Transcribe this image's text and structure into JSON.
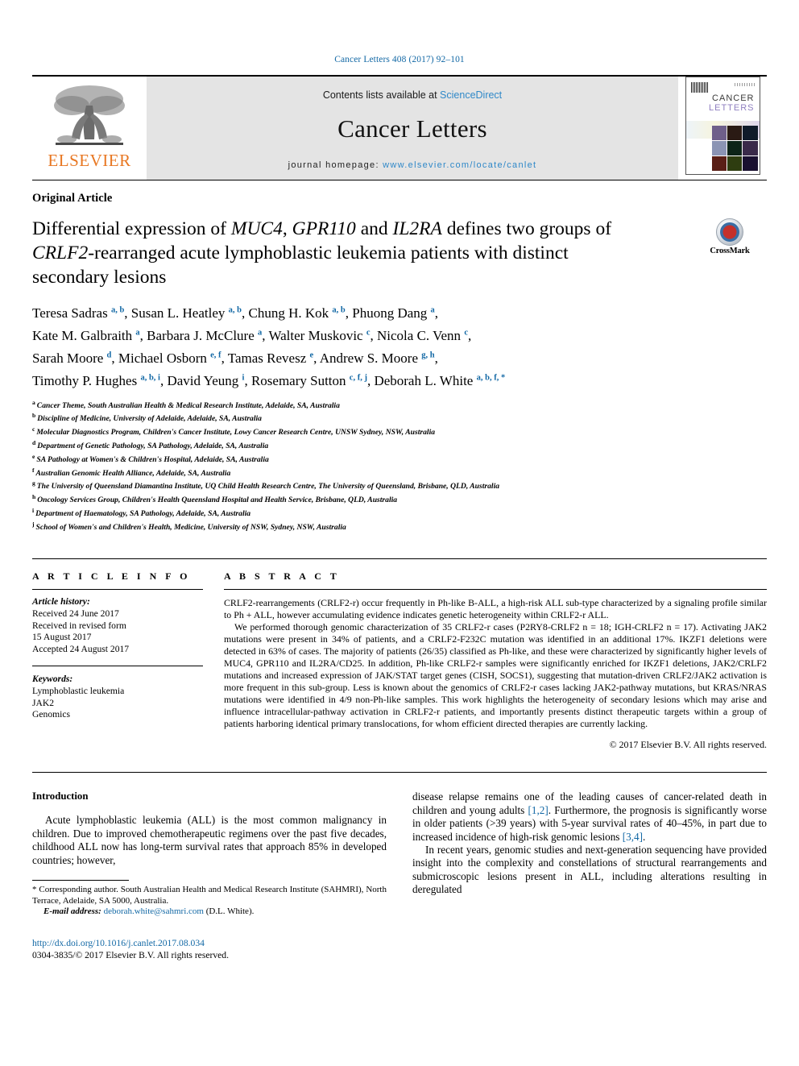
{
  "running_head": "Cancer Letters 408 (2017) 92–101",
  "banner": {
    "publisher_name": "ELSEVIER",
    "contents_prefix": "Contents lists available at ",
    "contents_link": "ScienceDirect",
    "journal_title": "Cancer Letters",
    "homepage_prefix": "journal homepage: ",
    "homepage_url": "www.elsevier.com/locate/canlet",
    "cover": {
      "line1": "CANCER",
      "line2": "LETTERS"
    }
  },
  "article": {
    "type": "Original Article",
    "title_part1": "Differential expression of ",
    "title_gene1": "MUC4",
    "title_part2": ", ",
    "title_gene2": "GPR110",
    "title_part3": " and ",
    "title_gene3": "IL2RA",
    "title_part4": " defines two groups of ",
    "title_gene4": "CRLF2",
    "title_part5": "-rearranged acute lymphoblastic leukemia patients with distinct secondary lesions",
    "crossmark_label": "CrossMark"
  },
  "authors": [
    {
      "name": "Teresa Sadras",
      "sup": "a, b",
      "sep": ", "
    },
    {
      "name": "Susan L. Heatley",
      "sup": "a, b",
      "sep": ", "
    },
    {
      "name": "Chung H. Kok",
      "sup": "a, b",
      "sep": ", "
    },
    {
      "name": "Phuong Dang",
      "sup": "a",
      "sep": ", "
    },
    {
      "name": "Kate M. Galbraith",
      "sup": "a",
      "sep": ", "
    },
    {
      "name": "Barbara J. McClure",
      "sup": "a",
      "sep": ", "
    },
    {
      "name": "Walter Muskovic",
      "sup": "c",
      "sep": ", "
    },
    {
      "name": "Nicola C. Venn",
      "sup": "c",
      "sep": ", "
    },
    {
      "name": "Sarah Moore",
      "sup": "d",
      "sep": ", "
    },
    {
      "name": "Michael Osborn",
      "sup": "e, f",
      "sep": ", "
    },
    {
      "name": "Tamas Revesz",
      "sup": "e",
      "sep": ", "
    },
    {
      "name": "Andrew S. Moore",
      "sup": "g, h",
      "sep": ", "
    },
    {
      "name": "Timothy P. Hughes",
      "sup": "a, b, i",
      "sep": ", "
    },
    {
      "name": "David Yeung",
      "sup": "i",
      "sep": ", "
    },
    {
      "name": "Rosemary Sutton",
      "sup": "c, f, j",
      "sep": ", "
    },
    {
      "name": "Deborah L. White",
      "sup": "a, b, f, *",
      "sep": ""
    }
  ],
  "affiliations": [
    {
      "mark": "a",
      "text": "Cancer Theme, South Australian Health & Medical Research Institute, Adelaide, SA, Australia"
    },
    {
      "mark": "b",
      "text": "Discipline of Medicine, University of Adelaide, Adelaide, SA, Australia"
    },
    {
      "mark": "c",
      "text": "Molecular Diagnostics Program, Children's Cancer Institute, Lowy Cancer Research Centre, UNSW Sydney, NSW, Australia"
    },
    {
      "mark": "d",
      "text": "Department of Genetic Pathology, SA Pathology, Adelaide, SA, Australia"
    },
    {
      "mark": "e",
      "text": "SA Pathology at Women's & Children's Hospital, Adelaide, SA, Australia"
    },
    {
      "mark": "f",
      "text": "Australian Genomic Health Alliance, Adelaide, SA, Australia"
    },
    {
      "mark": "g",
      "text": "The University of Queensland Diamantina Institute, UQ Child Health Research Centre, The University of Queensland, Brisbane, QLD, Australia"
    },
    {
      "mark": "h",
      "text": "Oncology Services Group, Children's Health Queensland Hospital and Health Service, Brisbane, QLD, Australia"
    },
    {
      "mark": "i",
      "text": "Department of Haematology, SA Pathology, Adelaide, SA, Australia"
    },
    {
      "mark": "j",
      "text": "School of Women's and Children's Health, Medicine, University of NSW, Sydney, NSW, Australia"
    }
  ],
  "article_info": {
    "heading": "A R T I C L E  I N F O",
    "history_label": "Article history:",
    "history_lines": [
      "Received 24 June 2017",
      "Received in revised form",
      "15 August 2017",
      "Accepted 24 August 2017"
    ],
    "keywords_label": "Keywords:",
    "keywords": [
      "Lymphoblastic leukemia",
      "JAK2",
      "Genomics"
    ]
  },
  "abstract": {
    "heading": "A B S T R A C T",
    "para1": "CRLF2-rearrangements (CRLF2-r) occur frequently in Ph-like B-ALL, a high-risk ALL sub-type characterized by a signaling profile similar to Ph + ALL, however accumulating evidence indicates genetic heterogeneity within CRLF2-r ALL.",
    "para2": "We performed thorough genomic characterization of 35 CRLF2-r cases (P2RY8-CRLF2 n = 18; IGH-CRLF2 n = 17). Activating JAK2 mutations were present in 34% of patients, and a CRLF2-F232C mutation was identified in an additional 17%. IKZF1 deletions were detected in 63% of cases. The majority of patients (26/35) classified as Ph-like, and these were characterized by significantly higher levels of MUC4, GPR110 and IL2RA/CD25. In addition, Ph-like CRLF2-r samples were significantly enriched for IKZF1 deletions, JAK2/CRLF2 mutations and increased expression of JAK/STAT target genes (CISH, SOCS1), suggesting that mutation-driven CRLF2/JAK2 activation is more frequent in this sub-group. Less is known about the genomics of CRLF2-r cases lacking JAK2-pathway mutations, but KRAS/NRAS mutations were identified in 4/9 non-Ph-like samples. This work highlights the heterogeneity of secondary lesions which may arise and influence intracellular-pathway activation in CRLF2-r patients, and importantly presents distinct therapeutic targets within a group of patients harboring identical primary translocations, for whom efficient directed therapies are currently lacking.",
    "copyright": "© 2017 Elsevier B.V. All rights reserved."
  },
  "body": {
    "section_title": "Introduction",
    "left_para1": "Acute lymphoblastic leukemia (ALL) is the most common malignancy in children. Due to improved chemotherapeutic regimens over the past five decades, childhood ALL now has long-term survival rates that approach 85% in developed countries; however,",
    "right_para1_a": "disease relapse remains one of the leading causes of cancer-related death in children and young adults ",
    "right_ref1": "[1,2]",
    "right_para1_b": ". Furthermore, the prognosis is significantly worse in older patients (>39 years) with 5-year survival rates of 40–45%, in part due to increased incidence of high-risk genomic lesions ",
    "right_ref2": "[3,4]",
    "right_para1_c": ".",
    "right_para2": "In recent years, genomic studies and next-generation sequencing have provided insight into the complexity and constellations of structural rearrangements and submicroscopic lesions present in ALL, including alterations resulting in deregulated"
  },
  "footnote": {
    "star": "*",
    "corresponding": " Corresponding author. South Australian Health and Medical Research Institute (SAHMRI), North Terrace, Adelaide, SA 5000, Australia.",
    "email_label": "E-mail address:",
    "email": "deborah.white@sahmri.com",
    "email_suffix": " (D.L. White)."
  },
  "doi_block": {
    "doi": "http://dx.doi.org/10.1016/j.canlet.2017.08.034",
    "issn_line": "0304-3835/© 2017 Elsevier B.V. All rights reserved."
  }
}
